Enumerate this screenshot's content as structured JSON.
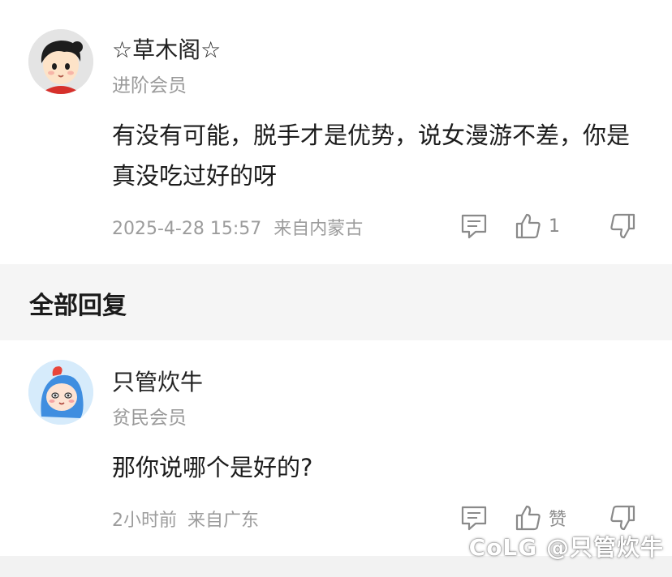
{
  "comment1": {
    "username": "☆草木阁☆",
    "level": "进阶会员",
    "content": "有没有可能，脱手才是优势，说女漫游不差，你是真没吃过好的呀",
    "time": "2025-4-28 15:57",
    "location": "来自内蒙古",
    "like_count": "1"
  },
  "section": {
    "title": "全部回复"
  },
  "comment2": {
    "username": "只管炊牛",
    "level": "贫民会员",
    "content": "那你说哪个是好的?",
    "time": "2小时前",
    "location": "来自广东",
    "like_label": "赞"
  },
  "watermark": "CoLG @只管炊牛",
  "icons": {
    "reply": "reply-icon",
    "like": "thumbs-up-icon",
    "dislike": "thumbs-down-icon"
  },
  "colors": {
    "meta_gray": "#9c9c9c",
    "section_bg": "#f5f5f5"
  }
}
